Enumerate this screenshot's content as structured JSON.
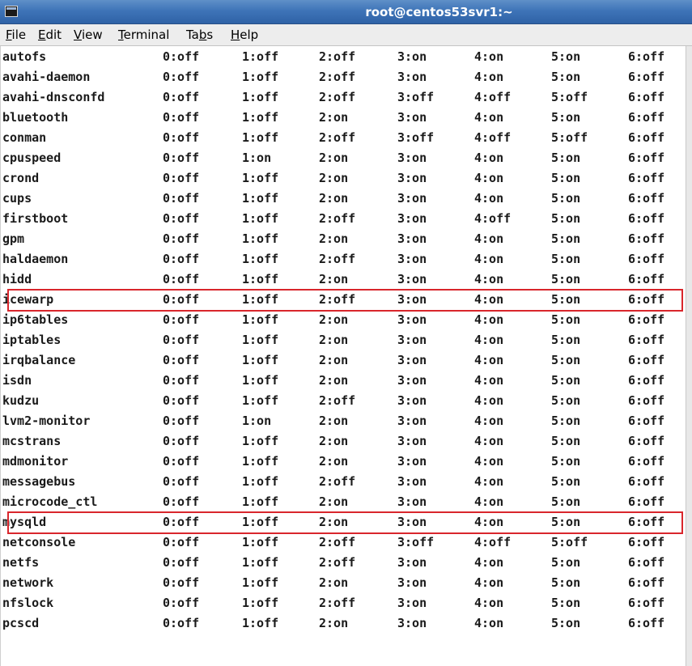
{
  "window": {
    "title": "root@centos53svr1:~"
  },
  "menu": {
    "items": [
      {
        "pre": "",
        "mnemonic": "F",
        "post": "ile"
      },
      {
        "pre": "",
        "mnemonic": "E",
        "post": "dit"
      },
      {
        "pre": "",
        "mnemonic": "V",
        "post": "iew"
      },
      {
        "pre": "",
        "mnemonic": "T",
        "post": "erminal"
      },
      {
        "pre": "Ta",
        "mnemonic": "b",
        "post": "s"
      },
      {
        "pre": "",
        "mnemonic": "H",
        "post": "elp"
      }
    ]
  },
  "terminal": {
    "rows": [
      {
        "service": "autofs",
        "levels": [
          "0:off",
          "1:off",
          "2:off",
          "3:on",
          "4:on",
          "5:on",
          "6:off"
        ]
      },
      {
        "service": "avahi-daemon",
        "levels": [
          "0:off",
          "1:off",
          "2:off",
          "3:on",
          "4:on",
          "5:on",
          "6:off"
        ]
      },
      {
        "service": "avahi-dnsconfd",
        "levels": [
          "0:off",
          "1:off",
          "2:off",
          "3:off",
          "4:off",
          "5:off",
          "6:off"
        ]
      },
      {
        "service": "bluetooth",
        "levels": [
          "0:off",
          "1:off",
          "2:on",
          "3:on",
          "4:on",
          "5:on",
          "6:off"
        ]
      },
      {
        "service": "conman",
        "levels": [
          "0:off",
          "1:off",
          "2:off",
          "3:off",
          "4:off",
          "5:off",
          "6:off"
        ]
      },
      {
        "service": "cpuspeed",
        "levels": [
          "0:off",
          "1:on",
          "2:on",
          "3:on",
          "4:on",
          "5:on",
          "6:off"
        ]
      },
      {
        "service": "crond",
        "levels": [
          "0:off",
          "1:off",
          "2:on",
          "3:on",
          "4:on",
          "5:on",
          "6:off"
        ]
      },
      {
        "service": "cups",
        "levels": [
          "0:off",
          "1:off",
          "2:on",
          "3:on",
          "4:on",
          "5:on",
          "6:off"
        ]
      },
      {
        "service": "firstboot",
        "levels": [
          "0:off",
          "1:off",
          "2:off",
          "3:on",
          "4:off",
          "5:on",
          "6:off"
        ]
      },
      {
        "service": "gpm",
        "levels": [
          "0:off",
          "1:off",
          "2:on",
          "3:on",
          "4:on",
          "5:on",
          "6:off"
        ]
      },
      {
        "service": "haldaemon",
        "levels": [
          "0:off",
          "1:off",
          "2:off",
          "3:on",
          "4:on",
          "5:on",
          "6:off"
        ]
      },
      {
        "service": "hidd",
        "levels": [
          "0:off",
          "1:off",
          "2:on",
          "3:on",
          "4:on",
          "5:on",
          "6:off"
        ]
      },
      {
        "service": "icewarp",
        "levels": [
          "0:off",
          "1:off",
          "2:off",
          "3:on",
          "4:on",
          "5:on",
          "6:off"
        ],
        "highlighted": true
      },
      {
        "service": "ip6tables",
        "levels": [
          "0:off",
          "1:off",
          "2:on",
          "3:on",
          "4:on",
          "5:on",
          "6:off"
        ]
      },
      {
        "service": "iptables",
        "levels": [
          "0:off",
          "1:off",
          "2:on",
          "3:on",
          "4:on",
          "5:on",
          "6:off"
        ]
      },
      {
        "service": "irqbalance",
        "levels": [
          "0:off",
          "1:off",
          "2:on",
          "3:on",
          "4:on",
          "5:on",
          "6:off"
        ]
      },
      {
        "service": "isdn",
        "levels": [
          "0:off",
          "1:off",
          "2:on",
          "3:on",
          "4:on",
          "5:on",
          "6:off"
        ]
      },
      {
        "service": "kudzu",
        "levels": [
          "0:off",
          "1:off",
          "2:off",
          "3:on",
          "4:on",
          "5:on",
          "6:off"
        ]
      },
      {
        "service": "lvm2-monitor",
        "levels": [
          "0:off",
          "1:on",
          "2:on",
          "3:on",
          "4:on",
          "5:on",
          "6:off"
        ]
      },
      {
        "service": "mcstrans",
        "levels": [
          "0:off",
          "1:off",
          "2:on",
          "3:on",
          "4:on",
          "5:on",
          "6:off"
        ]
      },
      {
        "service": "mdmonitor",
        "levels": [
          "0:off",
          "1:off",
          "2:on",
          "3:on",
          "4:on",
          "5:on",
          "6:off"
        ]
      },
      {
        "service": "messagebus",
        "levels": [
          "0:off",
          "1:off",
          "2:off",
          "3:on",
          "4:on",
          "5:on",
          "6:off"
        ]
      },
      {
        "service": "microcode_ctl",
        "levels": [
          "0:off",
          "1:off",
          "2:on",
          "3:on",
          "4:on",
          "5:on",
          "6:off"
        ]
      },
      {
        "service": "mysqld",
        "levels": [
          "0:off",
          "1:off",
          "2:on",
          "3:on",
          "4:on",
          "5:on",
          "6:off"
        ],
        "highlighted": true
      },
      {
        "service": "netconsole",
        "levels": [
          "0:off",
          "1:off",
          "2:off",
          "3:off",
          "4:off",
          "5:off",
          "6:off"
        ]
      },
      {
        "service": "netfs",
        "levels": [
          "0:off",
          "1:off",
          "2:off",
          "3:on",
          "4:on",
          "5:on",
          "6:off"
        ]
      },
      {
        "service": "network",
        "levels": [
          "0:off",
          "1:off",
          "2:on",
          "3:on",
          "4:on",
          "5:on",
          "6:off"
        ]
      },
      {
        "service": "nfslock",
        "levels": [
          "0:off",
          "1:off",
          "2:off",
          "3:on",
          "4:on",
          "5:on",
          "6:off"
        ]
      },
      {
        "service": "pcscd",
        "levels": [
          "0:off",
          "1:off",
          "2:on",
          "3:on",
          "4:on",
          "5:on",
          "6:off"
        ]
      }
    ]
  },
  "colors": {
    "titlebar": "#3e74b8",
    "highlight_box": "#d9262c",
    "terminal_text": "#1a1a1a",
    "terminal_bg": "#ffffff"
  }
}
